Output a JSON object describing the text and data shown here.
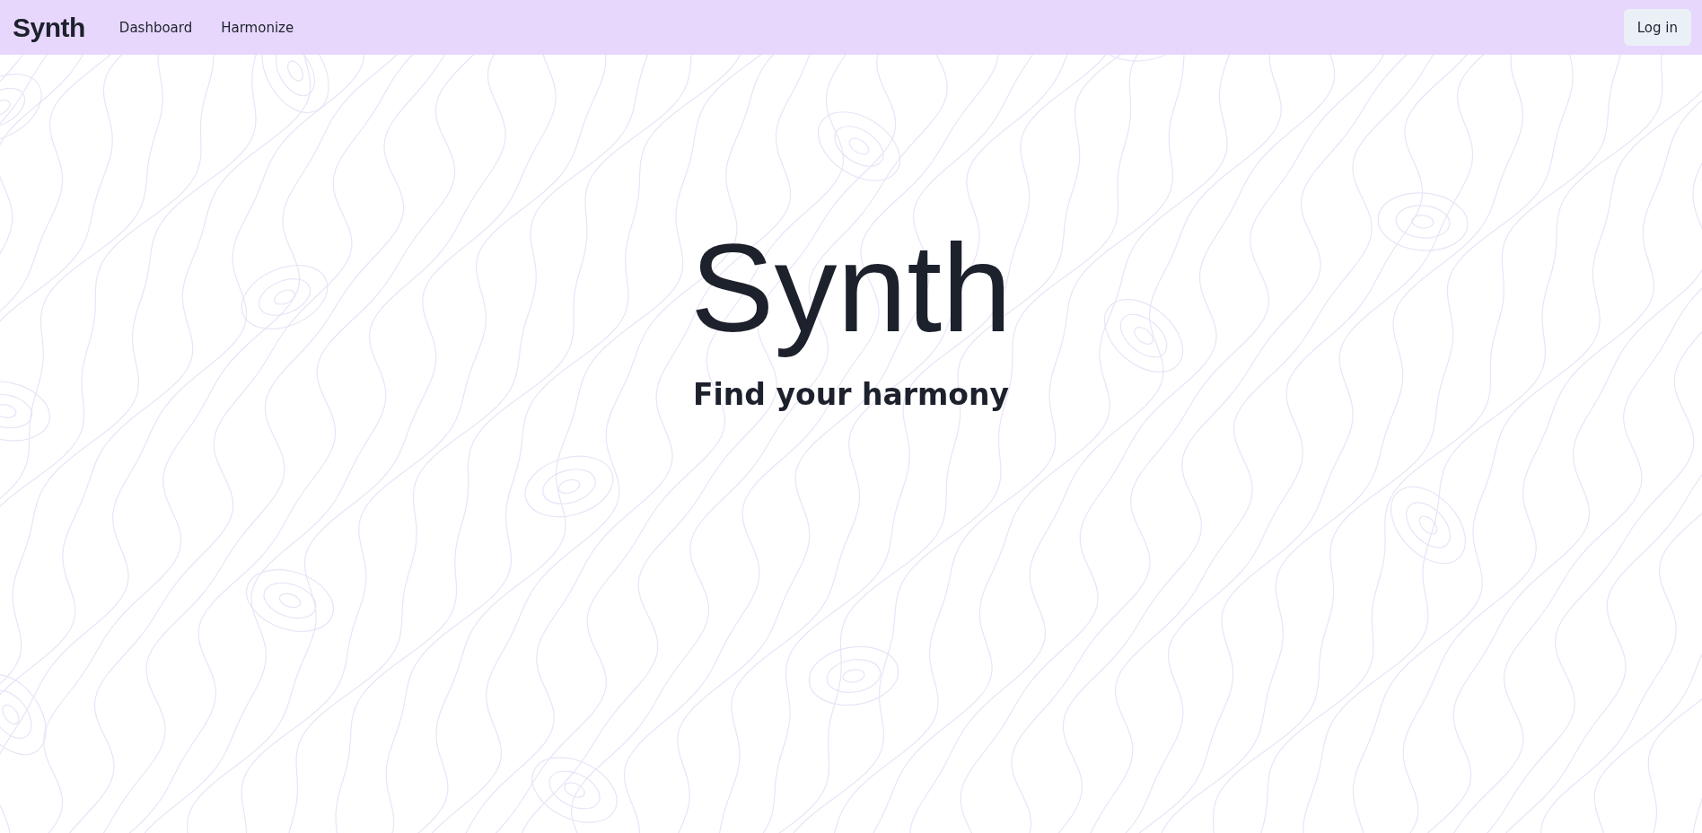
{
  "navbar": {
    "logo": "Synth",
    "links": [
      {
        "label": "Dashboard"
      },
      {
        "label": "Harmonize"
      }
    ],
    "login_button": "Log in"
  },
  "hero": {
    "title": "Synth",
    "subtitle": "Find your harmony"
  }
}
